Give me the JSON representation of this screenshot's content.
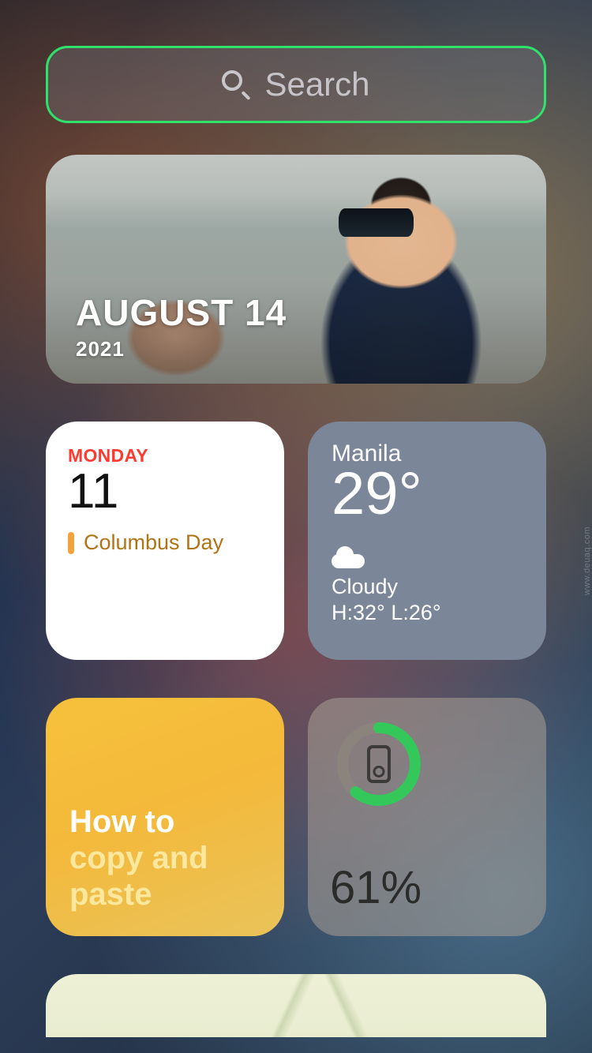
{
  "search": {
    "placeholder": "Search"
  },
  "photos": {
    "date": "AUGUST 14",
    "year": "2021"
  },
  "calendar": {
    "dayOfWeek": "MONDAY",
    "dayNum": "11",
    "event": "Columbus Day"
  },
  "weather": {
    "city": "Manila",
    "temp": "29°",
    "condition": "Cloudy",
    "hiLo": "H:32° L:26°"
  },
  "notes": {
    "line1": "How to",
    "line2": "copy and paste"
  },
  "battery": {
    "percent": 61,
    "percentLabel": "61%"
  },
  "watermark": "www.deuaq.com"
}
